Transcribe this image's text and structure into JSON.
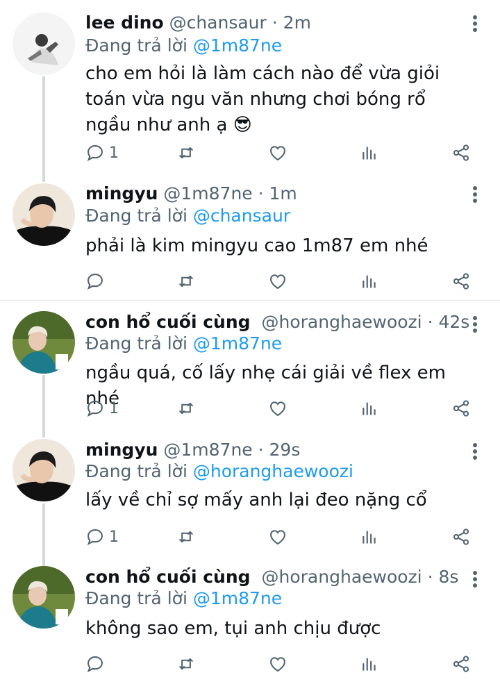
{
  "tweets": [
    {
      "name": "lee dino",
      "handle": "@chansaur",
      "sep": "·",
      "time": "2m",
      "reply_prefix": "Đang trả lời",
      "reply_to": "@1m87ne",
      "text": "cho em hỏi là làm cách nào để vừa giỏi toán vừa ngu văn nhưng chơi bóng rổ ngầu như anh ạ",
      "emoji": "😎",
      "reply_count": "1"
    },
    {
      "name": "mingyu",
      "handle": "@1m87ne",
      "sep": "·",
      "time": "1m",
      "reply_prefix": "Đang trả lời",
      "reply_to": "@chansaur",
      "text": "phải là kim mingyu cao 1m87 em nhé",
      "reply_count": ""
    },
    {
      "name": "con hổ cuối cùng",
      "handle": "@horanghaewoozi",
      "sep": "·",
      "time": "42s",
      "reply_prefix": "Đang trả lời",
      "reply_to": "@1m87ne",
      "text": "ngầu quá, cố lấy nhẹ cái giải về flex em nhé",
      "reply_count": "1"
    },
    {
      "name": "mingyu",
      "handle": "@1m87ne",
      "sep": "·",
      "time": "29s",
      "reply_prefix": "Đang trả lời",
      "reply_to": "@horanghaewoozi",
      "text": "lấy về chỉ sợ mấy anh lại đeo nặng cổ",
      "reply_count": "1"
    },
    {
      "name": "con hổ cuối cùng",
      "handle": "@horanghaewoozi",
      "sep": "·",
      "time": "8s",
      "reply_prefix": "Đang trả lời",
      "reply_to": "@1m87ne",
      "text": "không sao em, tụi anh chịu được",
      "reply_count": ""
    }
  ],
  "icons": [
    "more-icon",
    "reply-icon",
    "retweet-icon",
    "like-icon",
    "analytics-icon",
    "share-icon"
  ],
  "colors": {
    "text": "#0f1419",
    "muted": "#536471",
    "link": "#1d9bf0",
    "thread": "#cfd9de"
  }
}
